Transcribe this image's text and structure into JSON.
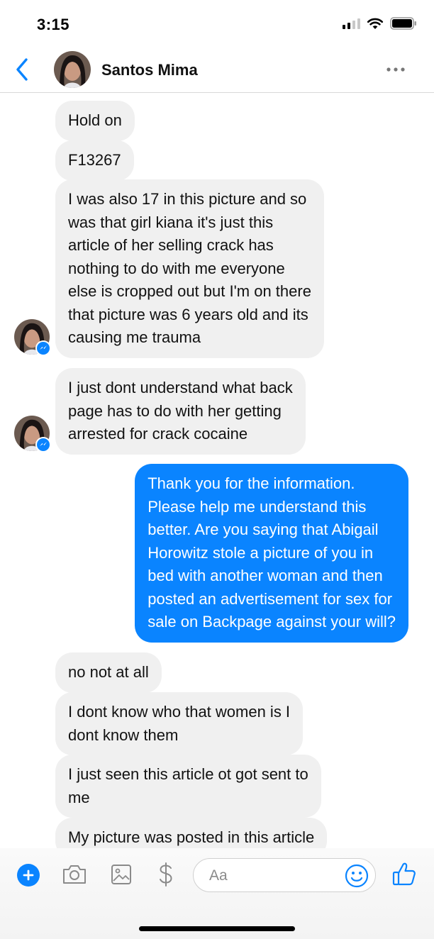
{
  "status_bar": {
    "time": "3:15"
  },
  "header": {
    "contact_name": "Santos Mima"
  },
  "messages": [
    {
      "direction": "in",
      "text": "Hold on"
    },
    {
      "direction": "in",
      "text": "F13267"
    },
    {
      "direction": "in",
      "text": "I was also 17 in this picture and so\nwas that girl kiana it's just this\narticle of her selling crack has\nnothing to do with me everyone\nelse is cropped out but I'm on there\nthat picture was 6 years old and its\ncausing me trauma"
    },
    {
      "direction": "in",
      "text": "I just dont understand what back\npage has to do with her getting\narrested for crack cocaine"
    },
    {
      "direction": "out",
      "text": "Thank you for the information.\nPlease help me understand this\nbetter. Are you saying that Abigail\nHorowitz stole a picture of you in\nbed with another woman and then\nposted an advertisement for sex for\nsale on Backpage against your will?"
    },
    {
      "direction": "in",
      "text": "no not at all"
    },
    {
      "direction": "in",
      "text": "I dont know who that women is I\ndont know them"
    },
    {
      "direction": "in",
      "text": "I just seen this article ot got sent to\nme"
    },
    {
      "direction": "in",
      "text": "My picture was posted in this article"
    }
  ],
  "composer": {
    "placeholder": "Aa"
  },
  "icons": [
    "back-chevron-icon",
    "more-icon",
    "plus-icon",
    "camera-icon",
    "gallery-icon",
    "dollar-icon",
    "emoji-icon",
    "thumbs-up-icon",
    "messenger-badge-icon"
  ],
  "colors": {
    "accent": "#0a84ff",
    "incoming_bubble": "#f0f0f0",
    "outgoing_text": "#ffffff"
  }
}
